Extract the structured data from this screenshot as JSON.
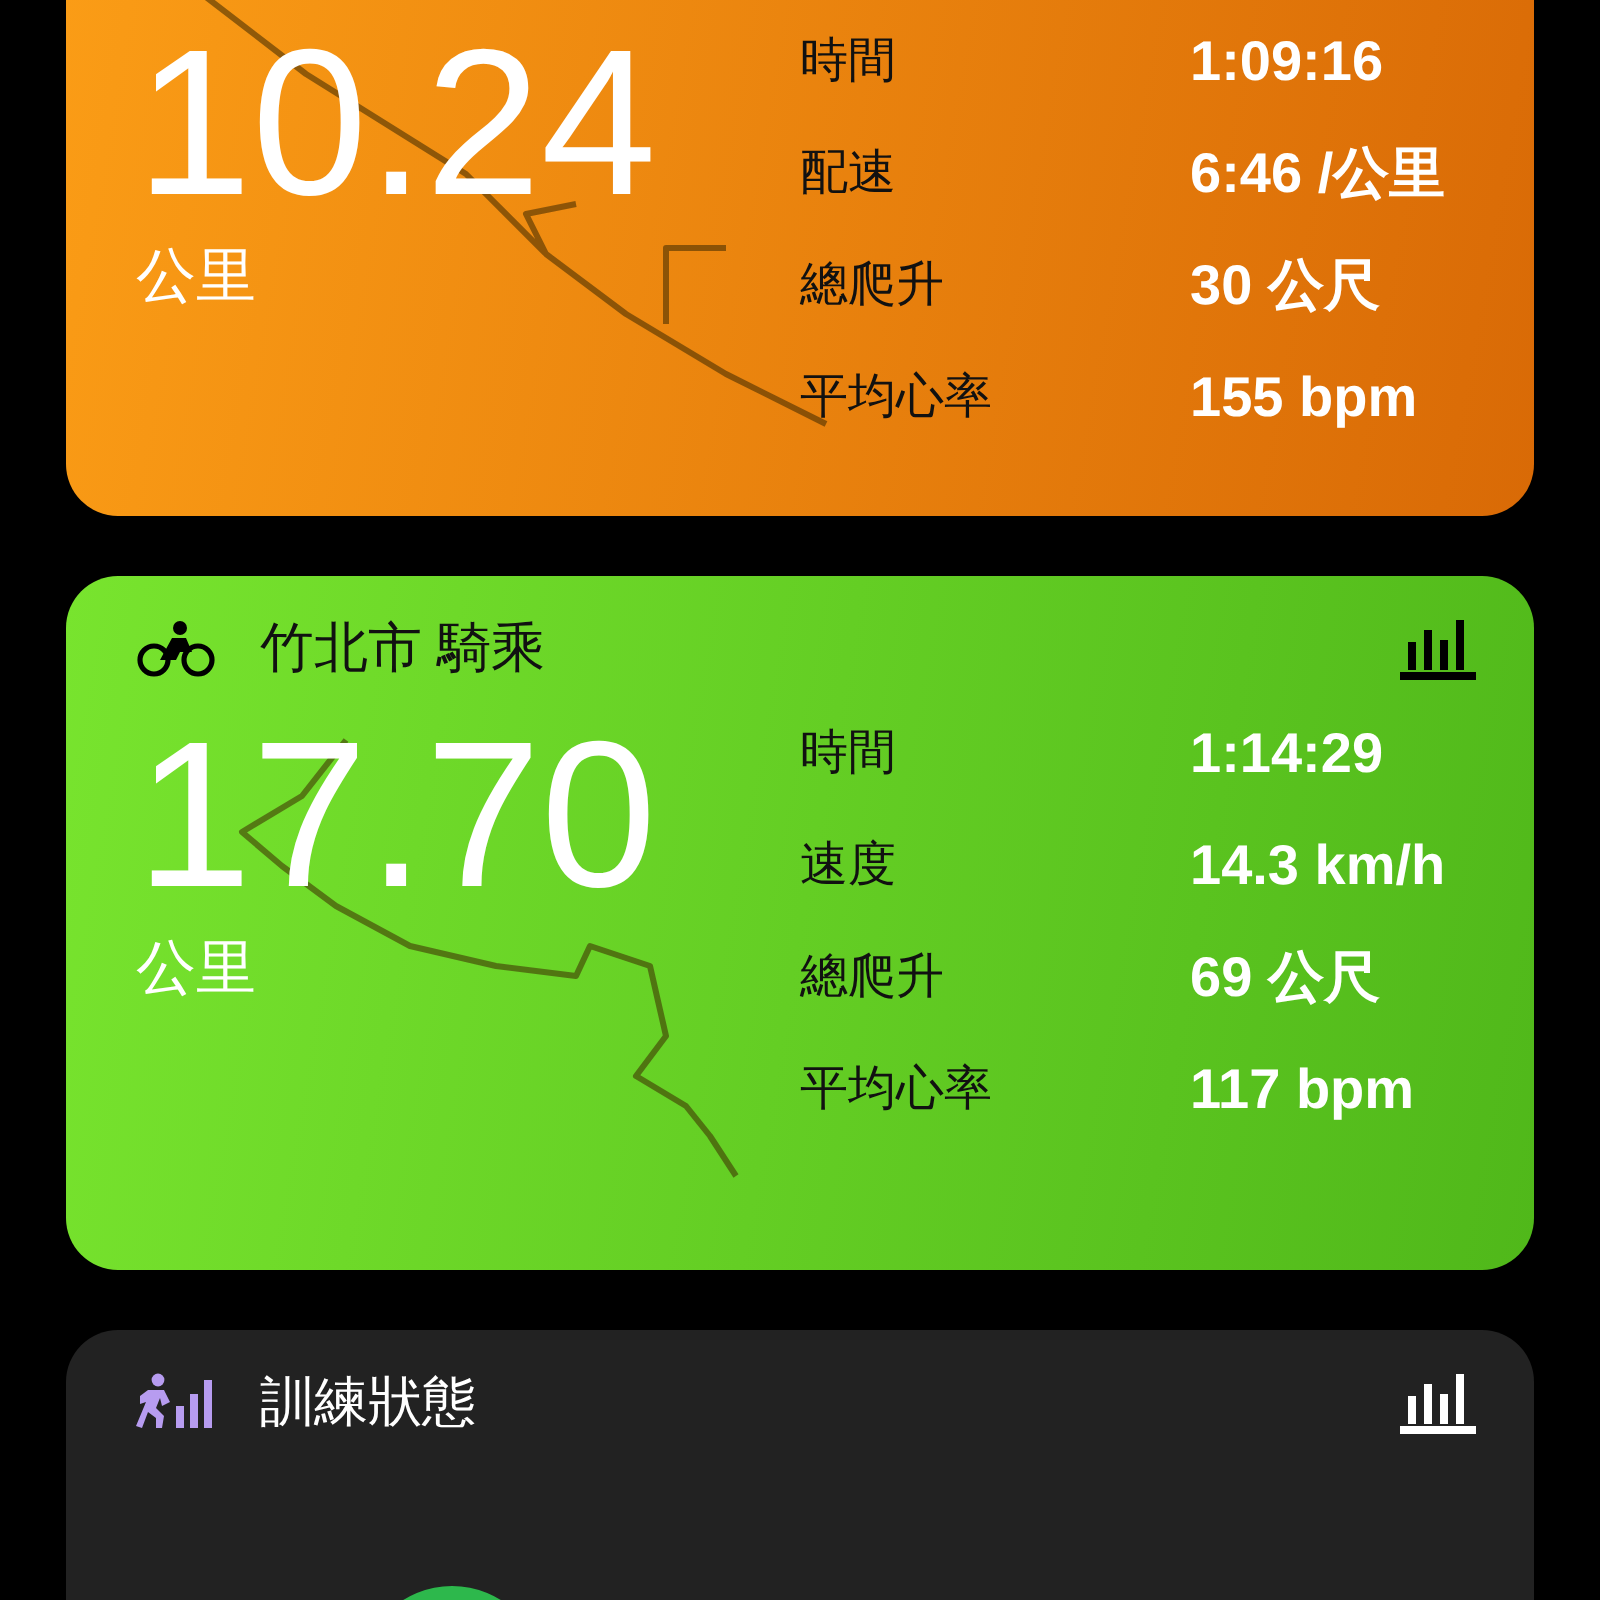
{
  "activities": [
    {
      "kind": "run",
      "distance": "10.24",
      "unit": "公里",
      "stats": [
        {
          "label": "時間",
          "value": "1:09:16"
        },
        {
          "label": "配速",
          "value": "6:46 /公里"
        },
        {
          "label": "總爬升",
          "value": "30 公尺"
        },
        {
          "label": "平均心率",
          "value": "155 bpm"
        }
      ]
    },
    {
      "kind": "ride",
      "title": "竹北市 騎乘",
      "distance": "17.70",
      "unit": "公里",
      "stats": [
        {
          "label": "時間",
          "value": "1:14:29"
        },
        {
          "label": "速度",
          "value": "14.3 km/h"
        },
        {
          "label": "總爬升",
          "value": "69 公尺"
        },
        {
          "label": "平均心率",
          "value": "117 bpm"
        }
      ]
    }
  ],
  "training_status": {
    "title": "訓練狀態"
  }
}
